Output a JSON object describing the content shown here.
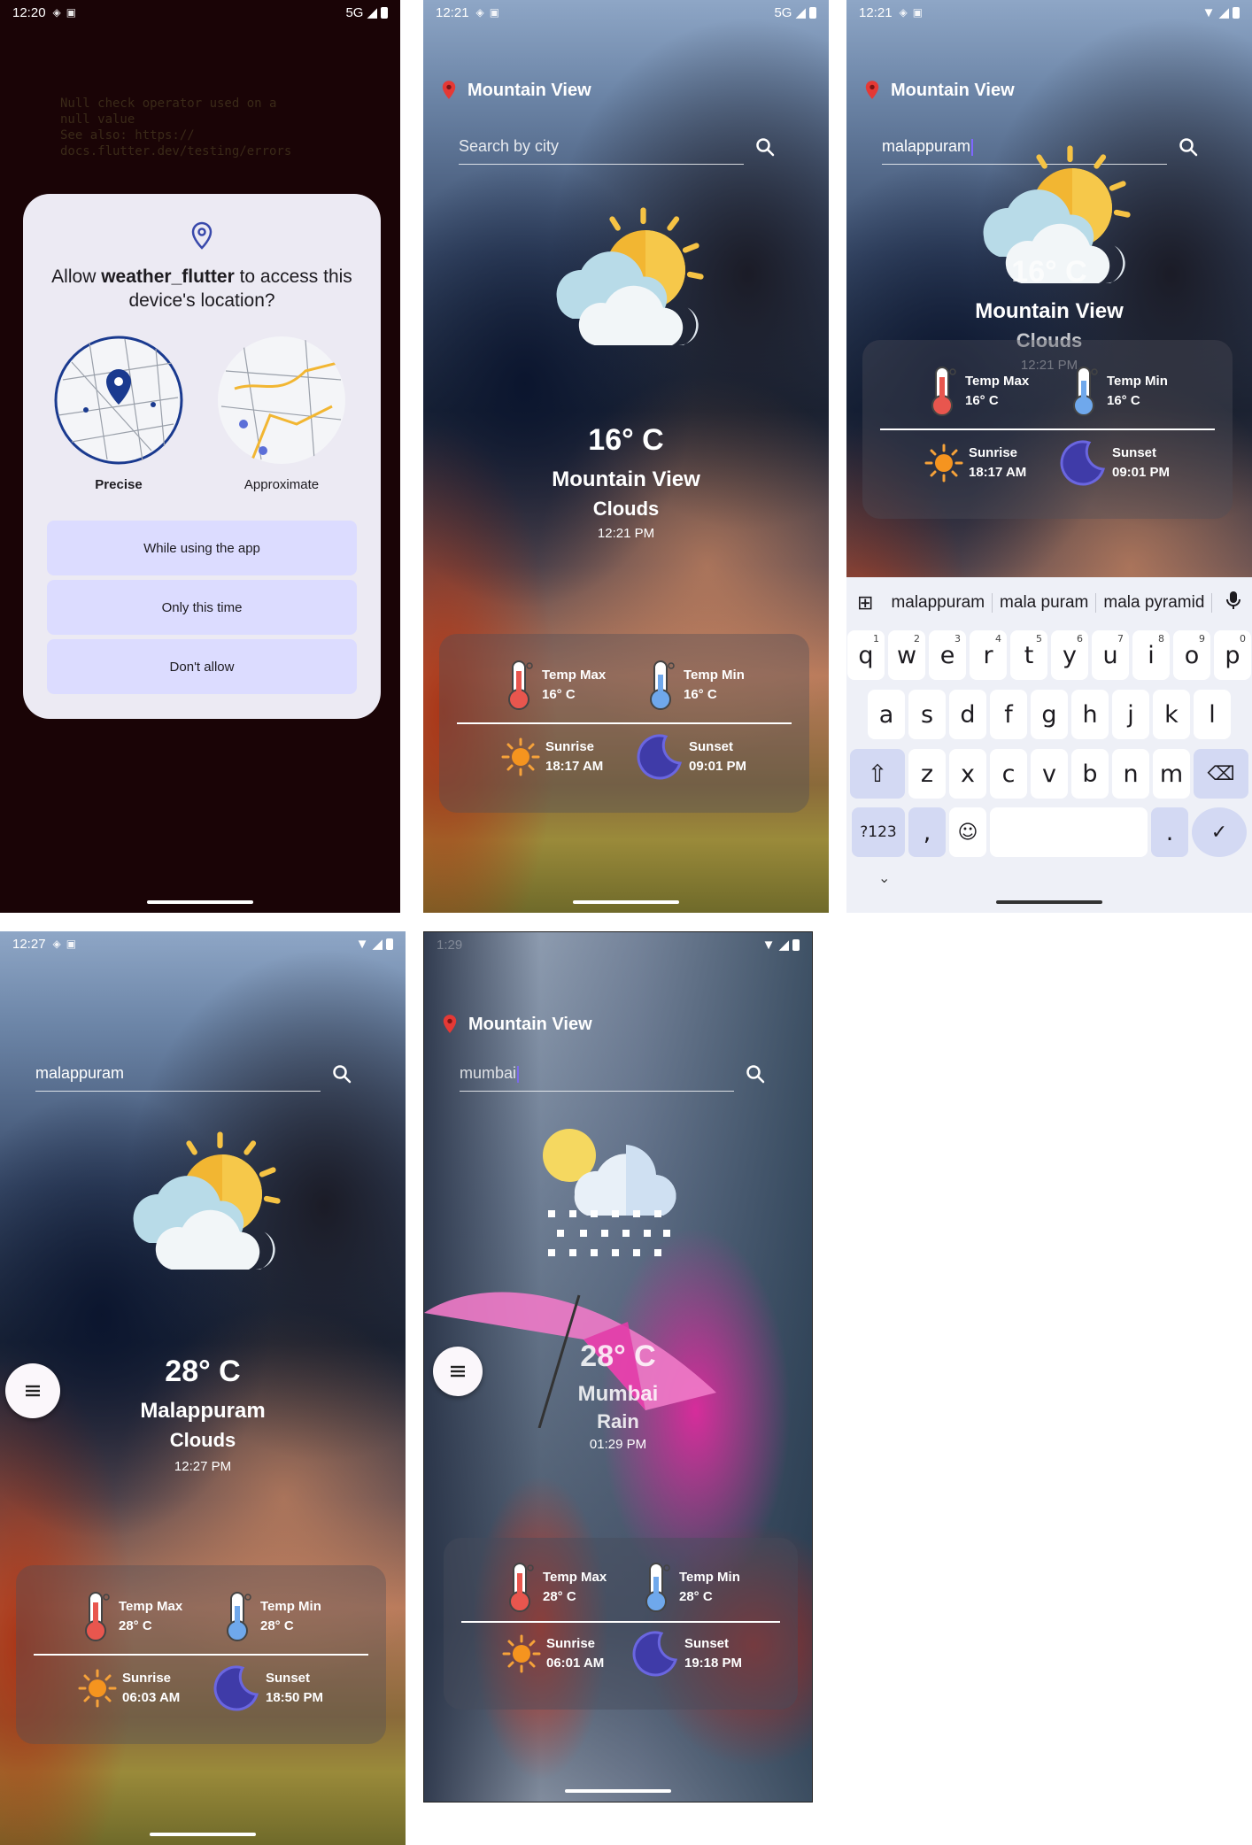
{
  "screen1": {
    "status": {
      "time": "12:20",
      "network": "5G"
    },
    "error_text": "Null check operator used on a\nnull value\nSee also: https://\ndocs.flutter.dev/testing/errors",
    "dialog": {
      "title_prefix": "Allow ",
      "app_name": "weather_flutter",
      "title_suffix": " to access this device's location?",
      "precise_label": "Precise",
      "approximate_label": "Approximate",
      "buttons": [
        "While using the app",
        "Only this time",
        "Don't allow"
      ]
    }
  },
  "screen2": {
    "status": {
      "time": "12:21",
      "network": "5G"
    },
    "location": "Mountain View",
    "search_placeholder": "Search by city",
    "temp": "16° C",
    "city": "Mountain View",
    "condition": "Clouds",
    "time": "12:21 PM",
    "temp_max_label": "Temp Max",
    "temp_max": "16° C",
    "temp_min_label": "Temp Min",
    "temp_min": "16° C",
    "sunrise_label": "Sunrise",
    "sunrise": "18:17 AM",
    "sunset_label": "Sunset",
    "sunset": "09:01 PM"
  },
  "screen3": {
    "status": {
      "time": "12:21"
    },
    "location": "Mountain View",
    "search_value": "malappuram",
    "temp": "16° C",
    "city": "Mountain View",
    "condition": "Clouds",
    "time": "12:21 PM",
    "temp_max_label": "Temp Max",
    "temp_max": "16° C",
    "temp_min_label": "Temp Min",
    "temp_min": "16° C",
    "sunrise_label": "Sunrise",
    "sunrise": "18:17 AM",
    "sunset_label": "Sunset",
    "sunset": "09:01 PM",
    "keyboard": {
      "suggestions": [
        "malappuram",
        "mala puram",
        "mala pyramid"
      ],
      "row1": [
        "q",
        "w",
        "e",
        "r",
        "t",
        "y",
        "u",
        "i",
        "o",
        "p"
      ],
      "row1_nums": [
        "1",
        "2",
        "3",
        "4",
        "5",
        "6",
        "7",
        "8",
        "9",
        "0"
      ],
      "row2": [
        "a",
        "s",
        "d",
        "f",
        "g",
        "h",
        "j",
        "k",
        "l"
      ],
      "row3": [
        "z",
        "x",
        "c",
        "v",
        "b",
        "n",
        "m"
      ],
      "symbols_key": "?123",
      "comma_key": ",",
      "period_key": "."
    }
  },
  "screen4": {
    "status": {
      "time": "12:27"
    },
    "search_value": "malappuram",
    "temp": "28° C",
    "city": "Malappuram",
    "condition": "Clouds",
    "time": "12:27 PM",
    "temp_max_label": "Temp Max",
    "temp_max": "28° C",
    "temp_min_label": "Temp Min",
    "temp_min": "28° C",
    "sunrise_label": "Sunrise",
    "sunrise": "06:03 AM",
    "sunset_label": "Sunset",
    "sunset": "18:50 PM"
  },
  "screen5": {
    "status": {
      "time": "1:29"
    },
    "location": "Mountain View",
    "search_value": "mumbai",
    "temp": "28° C",
    "city": "Mumbai",
    "condition": "Rain",
    "time": "01:29 PM",
    "temp_max_label": "Temp Max",
    "temp_max": "28° C",
    "temp_min_label": "Temp Min",
    "temp_min": "28° C",
    "sunrise_label": "Sunrise",
    "sunrise": "06:01 AM",
    "sunset_label": "Sunset",
    "sunset": "19:18 PM"
  },
  "colors": {
    "pin_red": "#e53935",
    "dialog_bg": "#eceaf3",
    "dialog_button": "#dcdcff",
    "accent": "#3949ab"
  }
}
